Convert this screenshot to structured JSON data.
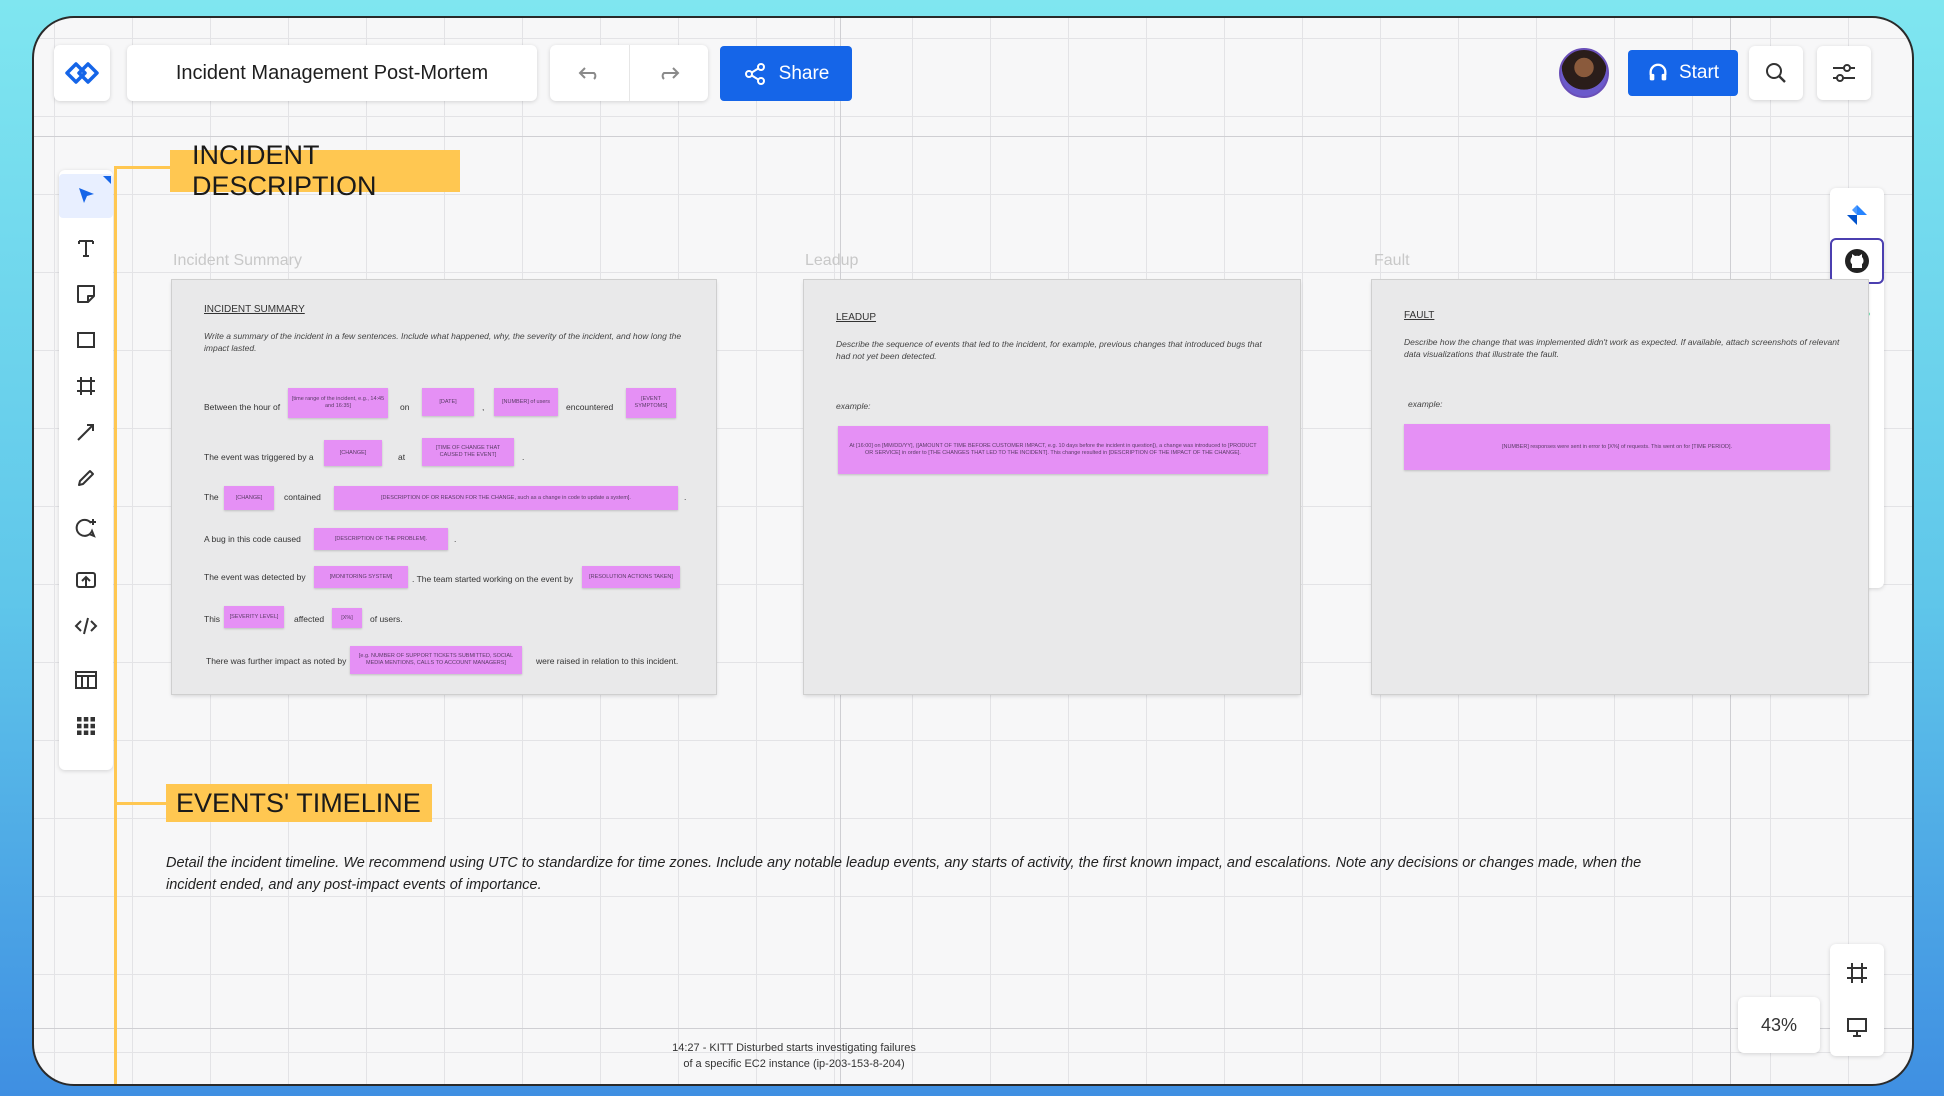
{
  "header": {
    "board_title": "Incident Management Post-Mortem",
    "share_label": "Share",
    "start_label": "Start",
    "undo_icon": "undo-icon",
    "redo_icon": "redo-icon"
  },
  "sections": {
    "incident_description": "INCIDENT DESCRIPTION",
    "events_timeline": "EVENTS' TIMELINE"
  },
  "frames": {
    "summary": {
      "frame_label": "Incident Summary",
      "title": "INCIDENT SUMMARY",
      "instructions": "Write a summary of the incident in a few sentences. Include what happened, why, the severity of the incident, and how long the impact lasted.",
      "row1": {
        "prefix": "Between the hour of",
        "s1": "[time range of the incident, e.g., 14:45 and 16:35]",
        "mid1": "on",
        "s2": "[DATE]",
        "sep": ",",
        "s3": "[NUMBER] of users",
        "mid2": "encountered",
        "s4": "[EVENT SYMPTOMS]"
      },
      "row2": {
        "prefix": "The event was triggered by a",
        "s1": "[CHANGE]",
        "mid": "at",
        "s2": "[TIME OF CHANGE THAT CAUSED THE EVENT]",
        "end": "."
      },
      "row3": {
        "prefix": "The",
        "s1": "[CHANGE]",
        "mid": "contained",
        "s2": "[DESCRIPTION OF OR REASON FOR THE CHANGE, such as a change in code to update a system].",
        "end": "."
      },
      "row4": {
        "prefix": "A bug in this code caused",
        "s1": "[DESCRIPTION OF THE PROBLEM].",
        "end": "."
      },
      "row5": {
        "prefix": "The event was detected by",
        "s1": "[MONITORING SYSTEM]",
        "mid": ". The team started working on the event by",
        "s2": "[RESOLUTION ACTIONS TAKEN]"
      },
      "row6": {
        "prefix": "This",
        "s1": "[SEVERITY LEVEL]",
        "mid": "affected",
        "s2": "[X%]",
        "end": "of users."
      },
      "row7": {
        "prefix": "There was further impact as noted by",
        "s1": "[e.g. NUMBER OF SUPPORT TICKETS SUBMITTED, SOCIAL MEDIA MENTIONS, CALLS TO ACCOUNT MANAGERS]",
        "end": "were raised in relation to this incident."
      }
    },
    "leadup": {
      "frame_label": "Leadup",
      "title": "LEADUP",
      "instructions": "Describe the sequence of events that led to the incident, for example, previous changes that introduced bugs that had not yet been detected.",
      "example_label": "example:",
      "sticky": "At [16:00] on [MM/DD/YY], ([AMOUNT OF TIME BEFORE CUSTOMER IMPACT, e.g. 10 days before the incident in question]), a change was introduced to [PRODUCT OR SERVICE] in order to [THE CHANGES THAT LED TO THE INCIDENT]. This change resulted in [DESCRIPTION OF THE IMPACT OF THE CHANGE]."
    },
    "fault": {
      "frame_label": "Fault",
      "title": "FAULT",
      "instructions": "Describe how the change that was implemented didn't work as expected. If available, attach screenshots of relevant data visualizations that illustrate the fault.",
      "example_label": "example:",
      "sticky": "[NUMBER] responses were sent in error to [X%] of requests. This went on for [TIME PERIOD]."
    }
  },
  "timeline": {
    "description": "Detail the incident timeline. We recommend using UTC to standardize for time zones. Include any notable leadup events, any starts of activity, the first known impact, and escalations. Note any decisions or changes made, when the incident ended, and any post-impact events of importance.",
    "note_line1": "14:27 - KITT Disturbed starts investigating failures",
    "note_line2": "of a specific EC2 instance (ip-203-153-8-204)"
  },
  "zoom": "43%",
  "left_tools": [
    "select-icon",
    "text-icon",
    "sticky-note-icon",
    "rectangle-icon",
    "frame-icon",
    "line-icon",
    "pen-icon",
    "comment-add-icon",
    "upload-icon",
    "embed-code-icon",
    "table-icon",
    "apps-grid-icon"
  ],
  "right_tools": [
    "jira-icon",
    "github-icon",
    "monday-icon",
    "chat-icon",
    "check-circle-icon",
    "timer-icon",
    "announce-icon",
    "help-icon"
  ],
  "colors": {
    "accent": "#1565e8",
    "sticky": "#e590f5",
    "section": "#ffc751"
  }
}
